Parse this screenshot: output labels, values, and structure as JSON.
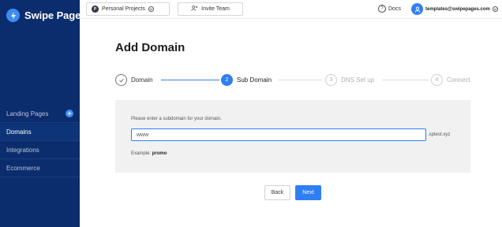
{
  "brand": {
    "name": "Swipe Pages",
    "icon": "lightning-logo-icon"
  },
  "sidebar": {
    "items": [
      {
        "label": "Landing Pages",
        "badge_icon": "plus-icon"
      },
      {
        "label": "Domains",
        "active": true
      },
      {
        "label": "Integrations"
      },
      {
        "label": "Ecommerce"
      }
    ]
  },
  "topbar": {
    "project": {
      "initial": "P",
      "label": "Personal Projects"
    },
    "invite_label": "Invite Team",
    "docs_label": "Docs",
    "user_email": "templates@swipepages.com"
  },
  "main": {
    "title": "Add Domain",
    "steps": [
      {
        "number": "",
        "label": "Domain",
        "state": "done"
      },
      {
        "number": "2",
        "label": "Sub Domain",
        "state": "current"
      },
      {
        "number": "3",
        "label": "DNS Set up",
        "state": "todo"
      },
      {
        "number": "4",
        "label": "Connect",
        "state": "todo"
      }
    ],
    "hint": "Please enter a subdomain for your domain.",
    "subdomain_value": "www",
    "domain_suffix": ".sptest.xyz",
    "example_label": "Example:",
    "example_value": "promo",
    "back_label": "Back",
    "next_label": "Next"
  },
  "colors": {
    "sidebar": "#0b2d6e",
    "accent": "#2f7ef6",
    "panel": "#f1f1f1"
  }
}
